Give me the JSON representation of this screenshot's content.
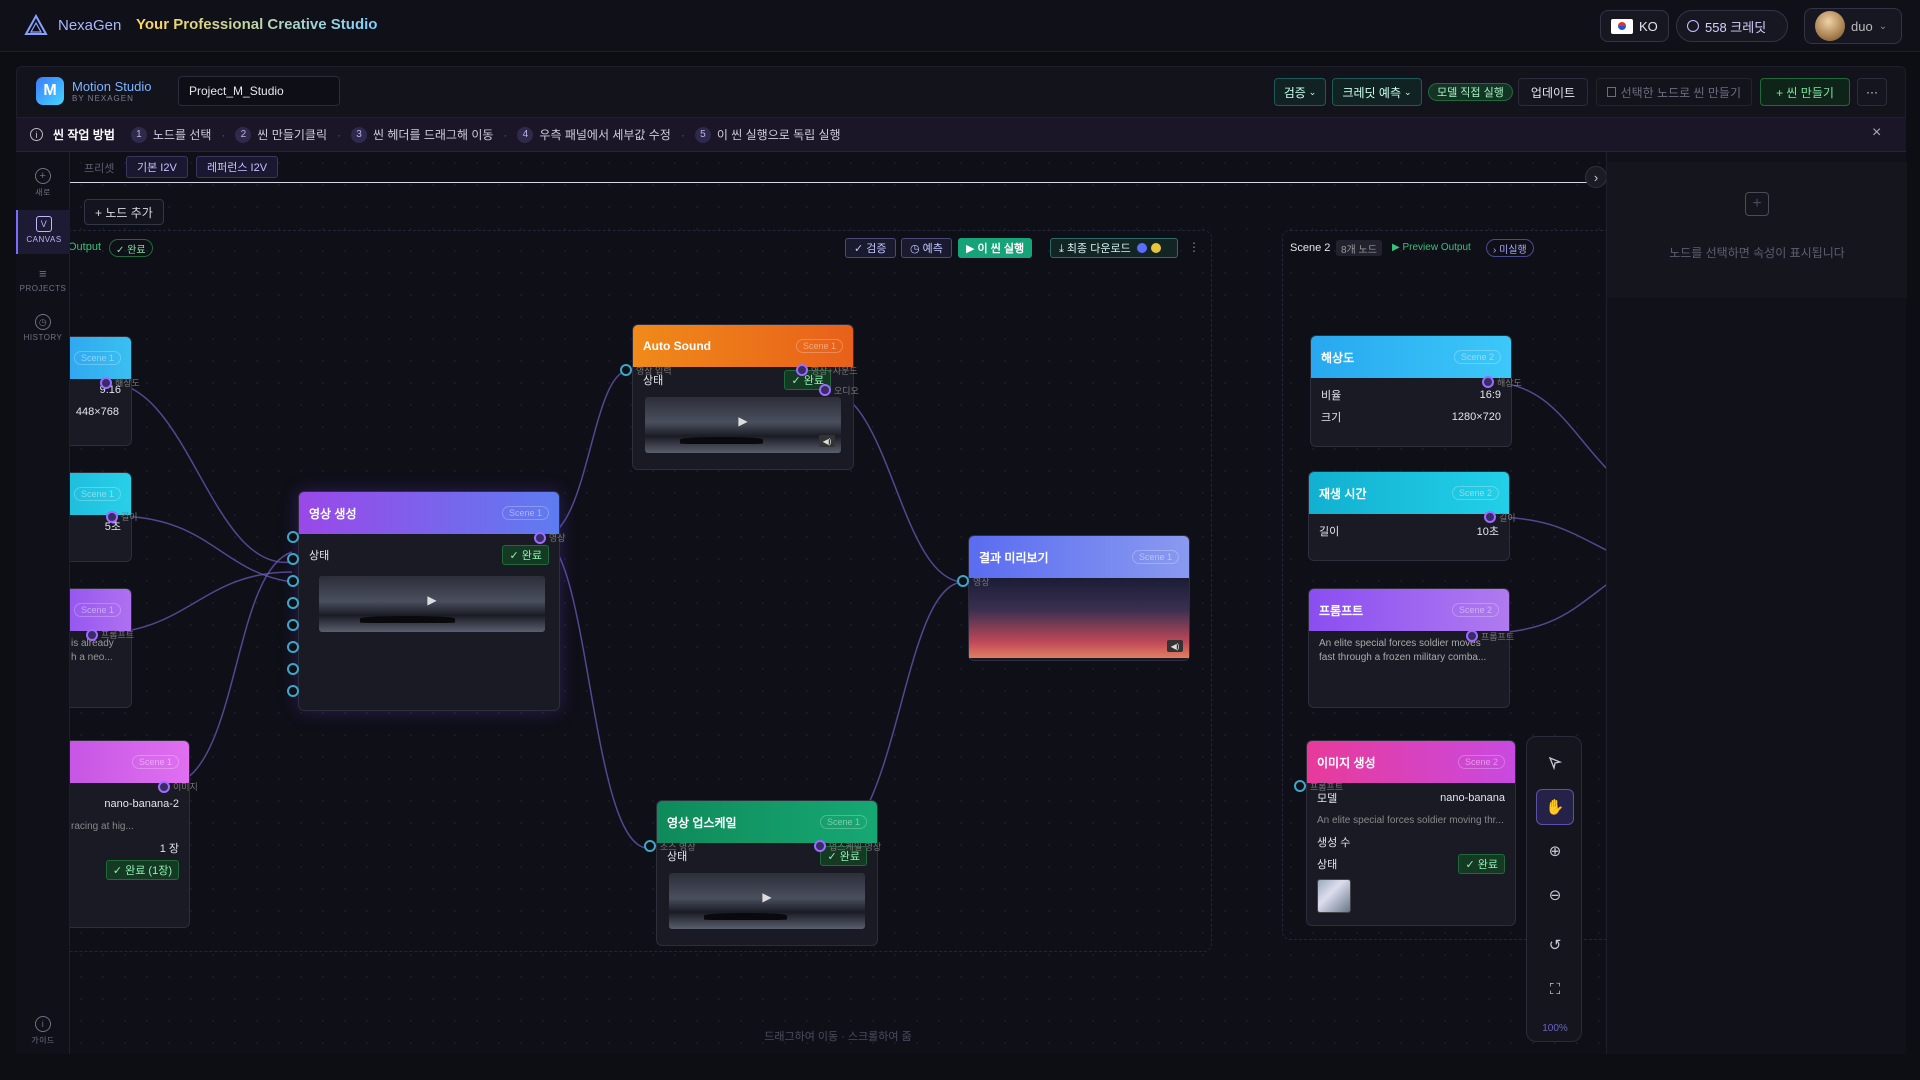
{
  "topbar": {
    "brand": "NexaGen",
    "tagline": "Your Professional Creative Studio",
    "lang": "KO",
    "credits": "558 크레딧",
    "user": "duo"
  },
  "app": {
    "name": "Motion Studio",
    "sub": "BY NEXAGEN",
    "project": "Project_M_Studio",
    "buttons": {
      "validate": "검증",
      "credit_estimate": "크레딧 예측",
      "model_direct": "모델 직접 실행",
      "update": "업데이트",
      "make_from_selected": "선택한 노드로 씬 만들기",
      "make_scene": "+ 씬 만들기",
      "more": "···"
    }
  },
  "guide": {
    "title": "씬 작업 방법",
    "steps": [
      {
        "num": "1",
        "text": "노드를 선택"
      },
      {
        "num": "2",
        "text": "씬 만들기클릭"
      },
      {
        "num": "3",
        "text": "씬 헤더를 드래그해 이동"
      },
      {
        "num": "4",
        "text": "우측 패널에서 세부값 수정"
      },
      {
        "num": "5",
        "text": "이 씬 실행으로 독립 실행"
      }
    ],
    "close": "×"
  },
  "nav": {
    "new": "새로",
    "canvas": "CANVAS",
    "projects": "PROJECTS",
    "history": "HISTORY",
    "guide": "가이드"
  },
  "canvas": {
    "preset_label": "프리셋",
    "presets": [
      "기본 I2V",
      "레퍼런스 I2V"
    ],
    "add_node": "+ 노드 추가",
    "hint": "드래그하여 이동 · 스크롤하여 줌",
    "zoom": "100%"
  },
  "scene1": {
    "output_label": "Output",
    "status": "✓ 완료",
    "tools": {
      "validate": "✓ 검증",
      "estimate": "◷ 예측",
      "run": "▶ 이 씬 실행",
      "download": "⤓ 최종 다운로드"
    }
  },
  "scene2": {
    "name": "Scene 2",
    "count": "8개 노드",
    "preview": "▶ Preview Output",
    "status": "› 미실행"
  },
  "nodes": {
    "left_res": {
      "ratio": "9:16",
      "size": "448×768",
      "port": "해상도"
    },
    "left_dur": {
      "value": "5초",
      "port": "길이"
    },
    "left_prompt": {
      "line1": "is already",
      "line2": "h a neo...",
      "port": "프롬프트"
    },
    "left_image": {
      "model": "nano-banana-2",
      "prompt": "racing at hig...",
      "count": "1 장",
      "status": "✓ 완료 (1장)",
      "port": "이미지"
    },
    "video_gen": {
      "title": "영상 생성",
      "tag": "Scene 1",
      "state_label": "상태",
      "status": "✓ 완료",
      "port_out": "영상"
    },
    "auto_sound": {
      "title": "Auto Sound",
      "tag": "Scene 1",
      "state_label": "상태",
      "status": "✓ 완료",
      "port_in": "영상 입력",
      "port_out1": "영상+사운드",
      "port_out2": "오디오"
    },
    "upscale": {
      "title": "영상 업스케일",
      "tag": "Scene 1",
      "state_label": "상태",
      "status": "✓ 완료",
      "port_in": "소스 영상",
      "port_out": "업스케일 영상"
    },
    "preview": {
      "title": "결과 미리보기",
      "tag": "Scene 1",
      "port_in": "영상"
    },
    "s2_res": {
      "title": "해상도",
      "tag": "Scene 2",
      "ratio_label": "비율",
      "ratio": "16:9",
      "size_label": "크기",
      "size": "1280×720",
      "port": "해상도"
    },
    "s2_dur": {
      "title": "재생 시간",
      "tag": "Scene 2",
      "label": "길이",
      "value": "10초",
      "port": "길이"
    },
    "s2_prompt": {
      "title": "프롬프트",
      "tag": "Scene 2",
      "text": "An elite special forces soldier moves fast through a frozen military comba...",
      "port": "프롬프트"
    },
    "s2_image": {
      "title": "이미지 생성",
      "tag": "Scene 2",
      "model_label": "모델",
      "model": "nano-banana",
      "prompt": "An elite special forces soldier moving thr...",
      "count_label": "생성 수",
      "state_label": "상태",
      "status": "✓ 완료",
      "port_in": "프롬프트"
    }
  },
  "rightpanel": {
    "empty": "노드를 선택하면 속성이 표시됩니다"
  }
}
